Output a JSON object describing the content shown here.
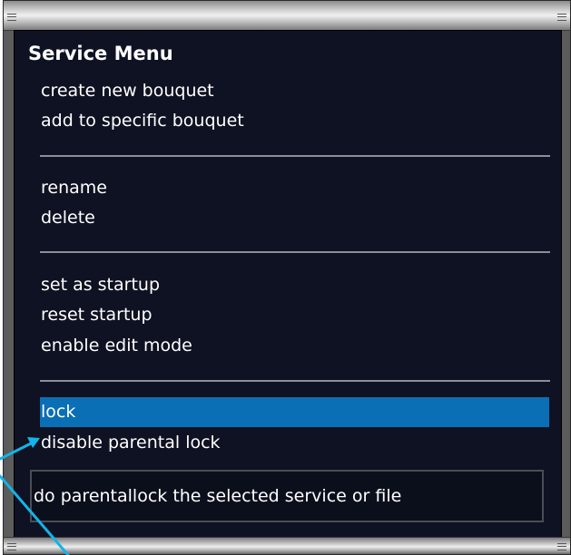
{
  "menu": {
    "title": "Service Menu",
    "groups": [
      {
        "items": [
          {
            "label": "create new bouquet"
          },
          {
            "label": "add to specific bouquet"
          }
        ]
      },
      {
        "items": [
          {
            "label": "rename"
          },
          {
            "label": "delete"
          }
        ]
      },
      {
        "items": [
          {
            "label": "set as startup"
          },
          {
            "label": "reset startup"
          },
          {
            "label": "enable edit mode"
          }
        ]
      },
      {
        "items": [
          {
            "label": "lock",
            "selected": true
          },
          {
            "label": "disable parental lock"
          }
        ]
      }
    ],
    "help_text": "do parentallock the selected service or file"
  },
  "colors": {
    "panel_bg": "#0e1222",
    "selection": "#0a6fb4",
    "annotation_arrow": "#12b4ea"
  }
}
